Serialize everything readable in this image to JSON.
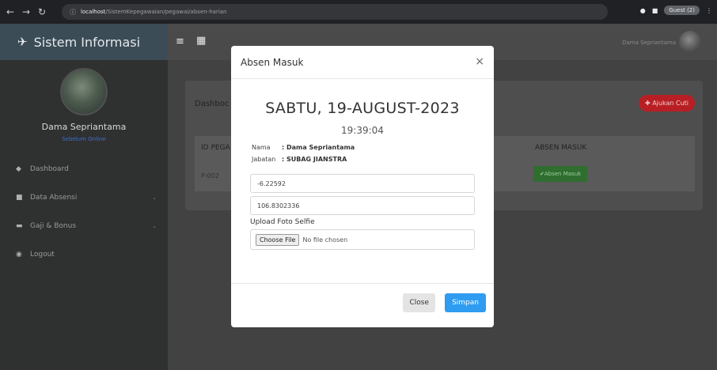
{
  "browser": {
    "url_host": "localhost",
    "url_path": "/SistemKepegawaian/pegawai/absen-harian",
    "profile_label": "Guest (2)"
  },
  "sidebar": {
    "brand": "Sistem Informasi",
    "user_name": "Dama Sepriantama",
    "user_status": "Sebelum Online",
    "items": [
      {
        "label": "Dashboard",
        "icon": "gauge-icon"
      },
      {
        "label": "Data Absensi",
        "icon": "bookmark-icon"
      },
      {
        "label": "Gaji & Bonus",
        "icon": "money-icon"
      },
      {
        "label": "Logout",
        "icon": "logout-icon"
      }
    ]
  },
  "topbar": {
    "user_name": "Dama Sepriantama"
  },
  "page": {
    "title": "Dashboc",
    "ajukan_cuti": "Ajukan Cuti",
    "table": {
      "col_id": "ID PEGA",
      "col_absen": "ABSEN MASUK",
      "row_id": "P-002",
      "absen_button": "Absen Masuk"
    }
  },
  "modal": {
    "title": "Absen Masuk",
    "close_symbol": "×",
    "date": "SABTU, 19-AUGUST-2023",
    "time": "19:39:04",
    "nama_label": "Nama",
    "nama_value": ": Dama Sepriantama",
    "jabatan_label": "Jabatan",
    "jabatan_value": ": SUBAG JIANSTRA",
    "latitude": "-6.22592",
    "longitude": "106.8302336",
    "upload_label": "Upload Foto Selfie",
    "choose_file": "Choose File",
    "no_file": "No file chosen",
    "close_button": "Close",
    "save_button": "Simpan"
  },
  "colors": {
    "accent": "#2e9cf0",
    "danger": "#b81f24",
    "success": "#2f6e2f"
  }
}
